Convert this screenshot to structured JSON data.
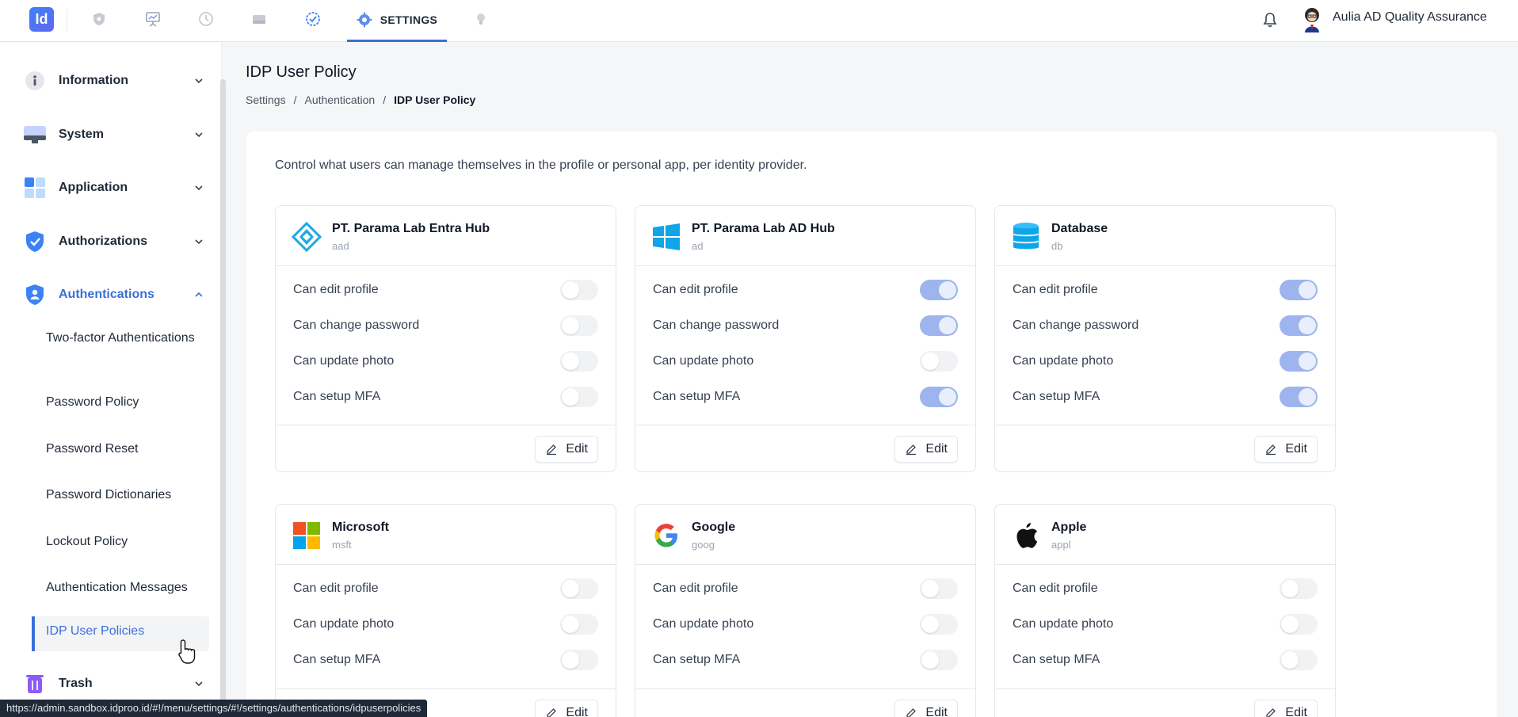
{
  "topbar": {
    "logo_text": "Id",
    "nav_icons": [
      "shield-icon",
      "presentation-icon",
      "history-icon",
      "drive-icon",
      "check-circle-icon",
      "gear-icon",
      "bulb-icon"
    ],
    "settings_label": "SETTINGS",
    "user_name": "Aulia AD Quality Assurance"
  },
  "sidebar": {
    "sections": [
      {
        "label": "Information",
        "icon": "info-icon"
      },
      {
        "label": "System",
        "icon": "monitor-icon"
      },
      {
        "label": "Application",
        "icon": "grid-icon"
      },
      {
        "label": "Authorizations",
        "icon": "shield-check-icon"
      },
      {
        "label": "Authentications",
        "icon": "shield-user-icon"
      },
      {
        "label": "Trash",
        "icon": "trash-icon"
      }
    ],
    "sub_items": [
      "Two-factor Authentications",
      "Password Policy",
      "Password Reset",
      "Password Dictionaries",
      "Lockout Policy",
      "Authentication Messages",
      "IDP User Policies"
    ]
  },
  "main": {
    "title": "IDP User Policy",
    "breadcrumb": [
      "Settings",
      "Authentication",
      "IDP User Policy"
    ],
    "description": "Control what users can manage themselves in the profile or personal app, per identity provider.",
    "edit_label": "Edit",
    "cards": [
      {
        "name": "PT. Parama Lab Entra Hub",
        "code": "aad",
        "icon": "entra-icon",
        "rows": [
          {
            "label": "Can edit profile",
            "on": false
          },
          {
            "label": "Can change password",
            "on": false
          },
          {
            "label": "Can update photo",
            "on": false
          },
          {
            "label": "Can setup MFA",
            "on": false
          }
        ]
      },
      {
        "name": "PT. Parama Lab AD Hub",
        "code": "ad",
        "icon": "windows-icon",
        "rows": [
          {
            "label": "Can edit profile",
            "on": true
          },
          {
            "label": "Can change password",
            "on": true
          },
          {
            "label": "Can update photo",
            "on": false
          },
          {
            "label": "Can setup MFA",
            "on": true
          }
        ]
      },
      {
        "name": "Database",
        "code": "db",
        "icon": "database-icon",
        "rows": [
          {
            "label": "Can edit profile",
            "on": true
          },
          {
            "label": "Can change password",
            "on": true
          },
          {
            "label": "Can update photo",
            "on": true
          },
          {
            "label": "Can setup MFA",
            "on": true
          }
        ]
      },
      {
        "name": "Microsoft",
        "code": "msft",
        "icon": "microsoft-icon",
        "rows": [
          {
            "label": "Can edit profile",
            "on": false
          },
          {
            "label": "Can update photo",
            "on": false
          },
          {
            "label": "Can setup MFA",
            "on": false
          }
        ]
      },
      {
        "name": "Google",
        "code": "goog",
        "icon": "google-icon",
        "rows": [
          {
            "label": "Can edit profile",
            "on": false
          },
          {
            "label": "Can update photo",
            "on": false
          },
          {
            "label": "Can setup MFA",
            "on": false
          }
        ]
      },
      {
        "name": "Apple",
        "code": "appl",
        "icon": "apple-icon",
        "rows": [
          {
            "label": "Can edit profile",
            "on": false
          },
          {
            "label": "Can update photo",
            "on": false
          },
          {
            "label": "Can setup MFA",
            "on": false
          }
        ]
      }
    ]
  },
  "status_url": "https://admin.sandbox.idproo.id/#!/menu/settings/#!/settings/authentications/idpuserpolicies"
}
